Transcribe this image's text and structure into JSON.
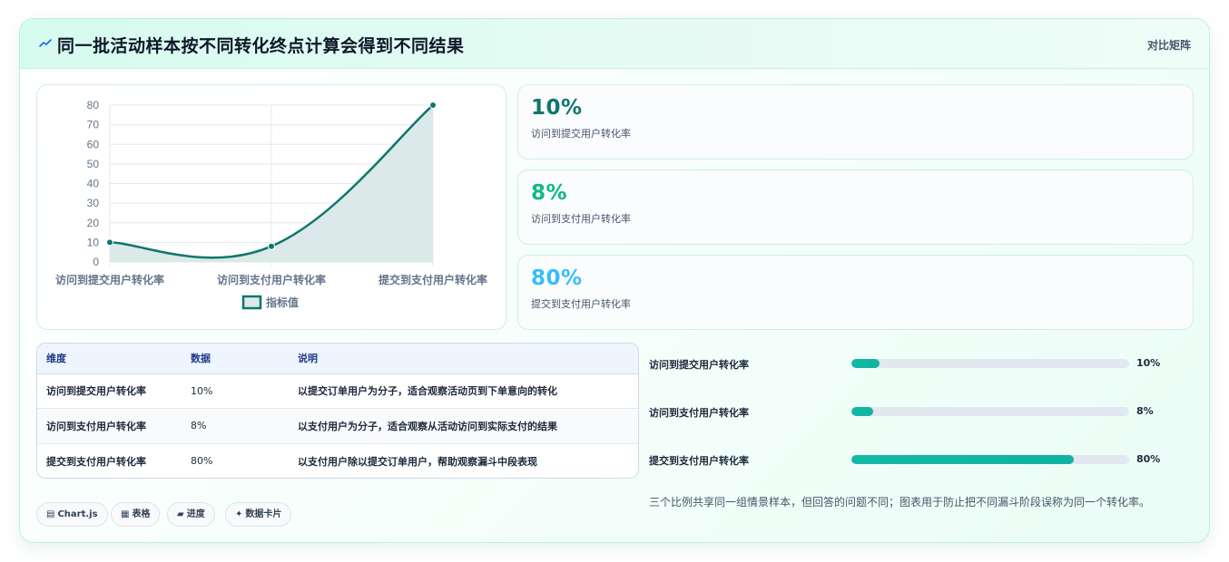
{
  "header": {
    "icon": "trend-line-icon",
    "title": "同一批活动样本按不同转化终点计算会得到不同结果",
    "badge": "对比矩阵"
  },
  "chart_data": {
    "type": "line",
    "categories": [
      "访问到提交用户转化率",
      "访问到支付用户转化率",
      "提交到支付用户转化率"
    ],
    "series": [
      {
        "name": "指标值",
        "values": [
          10,
          8,
          80
        ]
      }
    ],
    "ylim": [
      0,
      80
    ],
    "yticks": [
      0,
      10,
      20,
      30,
      40,
      50,
      60,
      70,
      80
    ],
    "fill": true,
    "smooth": true,
    "grid": true,
    "legend_position": "bottom",
    "colors": {
      "line": "#0f766e",
      "fill": "#dbe9e8",
      "grid": "#e5e7eb",
      "tick": "#64748b"
    }
  },
  "stats": [
    {
      "value": "10%",
      "label": "访问到提交用户转化率",
      "color": "#0f766e"
    },
    {
      "value": "8%",
      "label": "访问到支付用户转化率",
      "color": "#10b981"
    },
    {
      "value": "80%",
      "label": "提交到支付用户转化率",
      "color": "#38bdf8"
    }
  ],
  "table": {
    "headers": [
      "维度",
      "数据",
      "说明"
    ],
    "rows": [
      [
        "访问到提交用户转化率",
        "10%",
        "以提交订单用户为分子，适合观察活动页到下单意向的转化"
      ],
      [
        "访问到支付用户转化率",
        "8%",
        "以支付用户为分子，适合观察从活动访问到实际支付的结果"
      ],
      [
        "提交到支付用户转化率",
        "80%",
        "以支付用户除以提交订单用户，帮助观察漏斗中段表现"
      ]
    ]
  },
  "progress": [
    {
      "label": "访问到提交用户转化率",
      "percent": 10,
      "text": "10%"
    },
    {
      "label": "访问到支付用户转化率",
      "percent": 8,
      "text": "8%"
    },
    {
      "label": "提交到支付用户转化率",
      "percent": 80,
      "text": "80%"
    }
  ],
  "note": "三个比例共享同一组情景样本，但回答的问题不同；图表用于防止把不同漏斗阶段误称为同一个转化率。",
  "chips": [
    {
      "icon": "chart-icon",
      "glyph": "▤",
      "label": "Chart.js"
    },
    {
      "icon": "table-icon",
      "glyph": "▦",
      "label": "表格"
    },
    {
      "icon": "progress-icon",
      "glyph": "▰",
      "label": "进度"
    },
    {
      "icon": "sparkle-icon",
      "glyph": "✦",
      "label": "数据卡片"
    }
  ]
}
